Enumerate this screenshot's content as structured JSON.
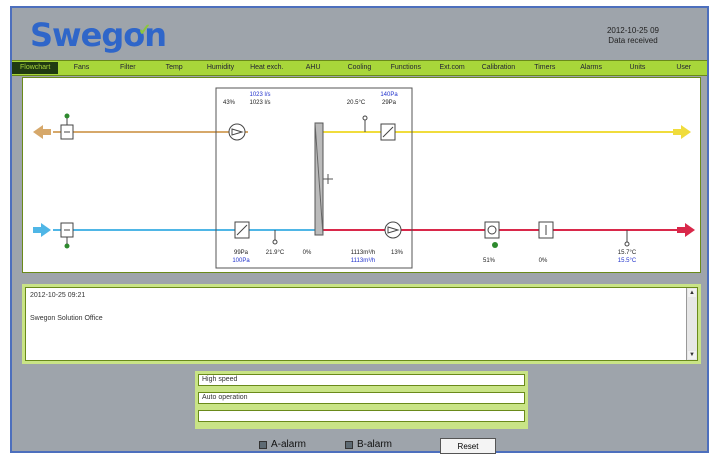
{
  "header": {
    "logo": "Swegon",
    "datetime": "2012-10-25 09",
    "status": "Data received"
  },
  "menu": {
    "items": [
      "Flowchart",
      "Fans",
      "Filter",
      "Temp",
      "Humidity",
      "Heat exch.",
      "AHU",
      "Cooling",
      "Functions",
      "Ext.com",
      "Calibration",
      "Timers",
      "Alarms",
      "Units",
      "User"
    ],
    "active_index": 0
  },
  "diagram": {
    "readings": {
      "extract_flow_setpoint": "1023 l/s",
      "extract_flow": "1023 l/s",
      "extract_fan_speed": "43%",
      "extract_temp": "20.5°C",
      "extract_pressure_setpoint": "140Pa",
      "extract_pressure": "29Pa",
      "supply_pressure": "99Pa",
      "supply_pressure_setpoint": "100Pa",
      "outdoor_temp": "21.9°C",
      "recovery": "0%",
      "supply_flow": "1113m³/h",
      "supply_flow_setpoint": "1113m³/h",
      "supply_fan_speed": "13%",
      "heating_valve": "51%",
      "cooling_valve": "0%",
      "supply_temp": "15.7°C",
      "supply_temp_setpoint": "15.5°C"
    },
    "colors": {
      "extract_air": "#d6a86a",
      "exhaust_air": "#f0dc3c",
      "outdoor_air": "#4fb6e6",
      "supply_air": "#d9284a"
    }
  },
  "messages": {
    "time": "2012-10-25 09:21",
    "text": "Swegon Solution Office"
  },
  "status_fields": [
    "High speed",
    "Auto operation",
    ""
  ],
  "alarms": {
    "a_label": "A-alarm",
    "b_label": "B-alarm",
    "reset_label": "Reset"
  }
}
